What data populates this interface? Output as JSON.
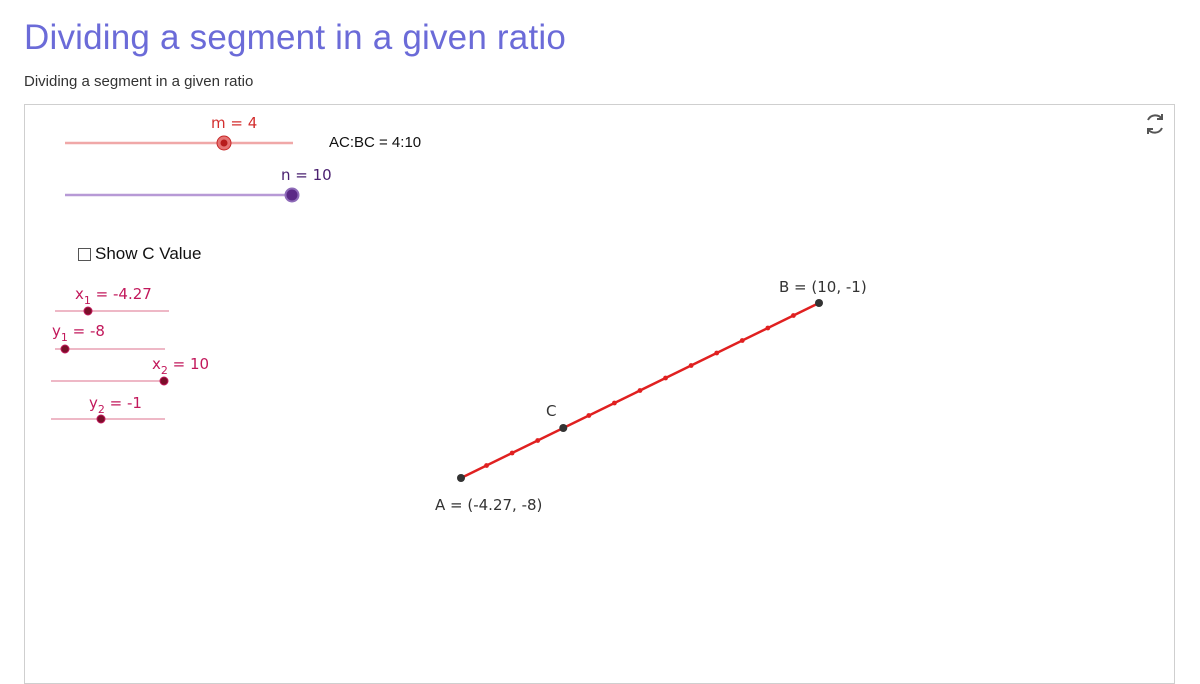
{
  "page": {
    "title": "Dividing a segment in a given ratio",
    "subtitle": "Dividing a segment in a given ratio"
  },
  "applet": {
    "ratio_text": "AC:BC = 4:10",
    "checkbox_label": "Show C Value",
    "checkbox_checked": false,
    "sliders": {
      "m": {
        "name": "m",
        "value": 4,
        "label": "m = 4",
        "min": 1,
        "max": 10,
        "color": "#d32f2f",
        "track_color": "#f0a8a8"
      },
      "n": {
        "name": "n",
        "value": 10,
        "label": "n = 10",
        "min": 1,
        "max": 10,
        "color": "#5b2a86",
        "track_color": "#b79ad6"
      },
      "x1": {
        "label_main": "x",
        "label_sub": "1",
        "label_rest": " = -4.27",
        "value": -4.27
      },
      "y1": {
        "label_main": "y",
        "label_sub": "1",
        "label_rest": " = -8",
        "value": -8
      },
      "x2": {
        "label_main": "x",
        "label_sub": "2",
        "label_rest": " = 10",
        "value": 10
      },
      "y2": {
        "label_main": "y",
        "label_sub": "2",
        "label_rest": " = -1",
        "value": -1
      }
    },
    "points": {
      "A": {
        "label": "A = (-4.27, -8)",
        "x": -4.27,
        "y": -8
      },
      "B": {
        "label": "B = (10, -1)",
        "x": 10,
        "y": -1
      },
      "C": {
        "label": "C"
      }
    },
    "segment_color": "#e02020",
    "coord_color": "#c2185b",
    "tick_marks": 14
  }
}
